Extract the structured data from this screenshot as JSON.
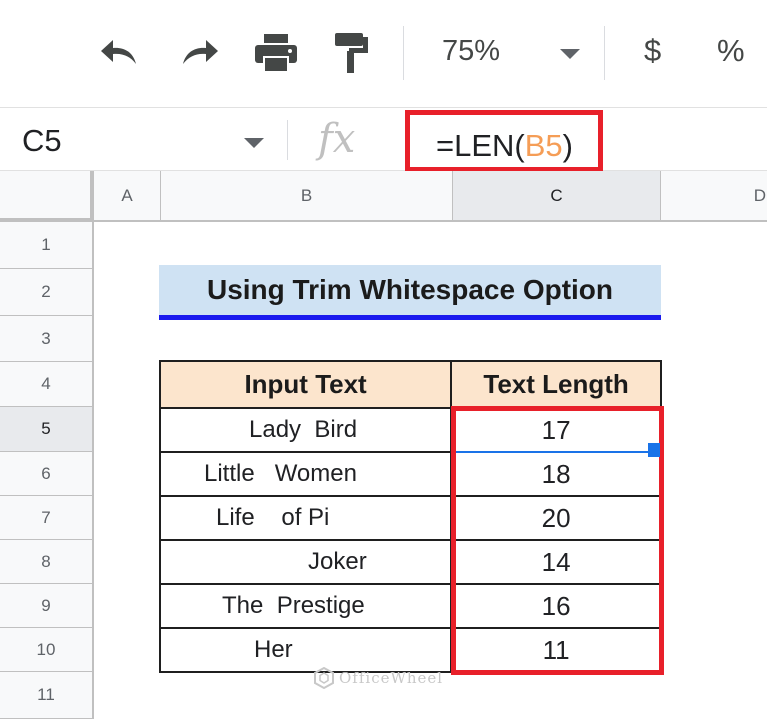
{
  "toolbar": {
    "undo_icon": "undo-icon",
    "redo_icon": "redo-icon",
    "print_icon": "print-icon",
    "paint_format_icon": "paint-format-icon",
    "zoom": "75%",
    "currency": "$",
    "percent": "%"
  },
  "formula_bar": {
    "name_box": "C5",
    "fx": "fx",
    "formula_prefix": "=LEN(",
    "formula_ref": "B5",
    "formula_suffix": ")"
  },
  "columns": [
    "A",
    "B",
    "C",
    "D"
  ],
  "rows": [
    "1",
    "2",
    "3",
    "4",
    "5",
    "6",
    "7",
    "8",
    "9",
    "10",
    "11"
  ],
  "sheet": {
    "title": "Using Trim Whitespace Option",
    "headers": [
      "Input Text",
      "Text Length"
    ],
    "rows": [
      {
        "input": "Lady  Bird",
        "length": "17"
      },
      {
        "input": "Little   Women",
        "length": "18"
      },
      {
        "input": "Life    of Pi",
        "length": "20"
      },
      {
        "input": "Joker",
        "length": "14"
      },
      {
        "input": "The  Prestige",
        "length": "16"
      },
      {
        "input": "Her",
        "length": "11"
      }
    ]
  },
  "watermark": "OfficeWheel",
  "colors": {
    "highlight": "#e8202a",
    "title_fill": "#cfe2f3",
    "header_fill": "#fce5cd",
    "selection": "#1a73e8",
    "formula_ref": "#f59d56"
  }
}
